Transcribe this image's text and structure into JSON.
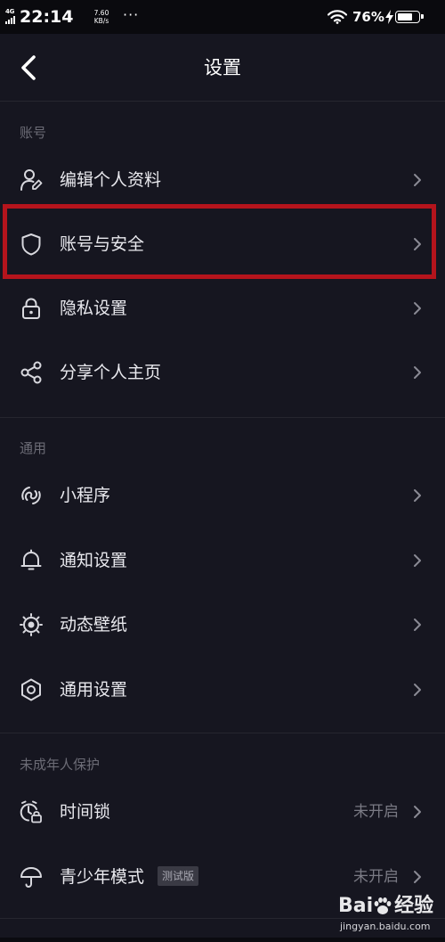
{
  "status_bar": {
    "network": "4G",
    "time": "22:14",
    "speed_value": "7.60",
    "speed_unit": "KB/s",
    "more": "···",
    "battery_percent": "76%",
    "battery_level": 0.76
  },
  "nav": {
    "title": "设置"
  },
  "sections": {
    "account": {
      "header": "账号",
      "items": [
        {
          "label": "编辑个人资料",
          "icon": "edit-profile-icon"
        },
        {
          "label": "账号与安全",
          "icon": "shield-icon"
        },
        {
          "label": "隐私设置",
          "icon": "lock-icon"
        },
        {
          "label": "分享个人主页",
          "icon": "share-icon"
        }
      ]
    },
    "general": {
      "header": "通用",
      "items": [
        {
          "label": "小程序",
          "icon": "mini-program-icon"
        },
        {
          "label": "通知设置",
          "icon": "bell-icon"
        },
        {
          "label": "动态壁纸",
          "icon": "dynamic-wallpaper-icon"
        },
        {
          "label": "通用设置",
          "icon": "hexagon-settings-icon"
        }
      ]
    },
    "minor": {
      "header": "未成年人保护",
      "items": [
        {
          "label": "时间锁",
          "icon": "time-lock-icon",
          "value": "未开启"
        },
        {
          "label": "青少年模式",
          "icon": "umbrella-icon",
          "tag": "测试版",
          "value": "未开启"
        }
      ]
    }
  },
  "watermark": {
    "brand": "Bai",
    "brand_suffix": "经验",
    "url": "jingyan.baidu.com"
  },
  "colors": {
    "background": "#161620",
    "highlight": "#b5141c",
    "text": "#e9e9ee",
    "muted": "#6c6c76"
  }
}
